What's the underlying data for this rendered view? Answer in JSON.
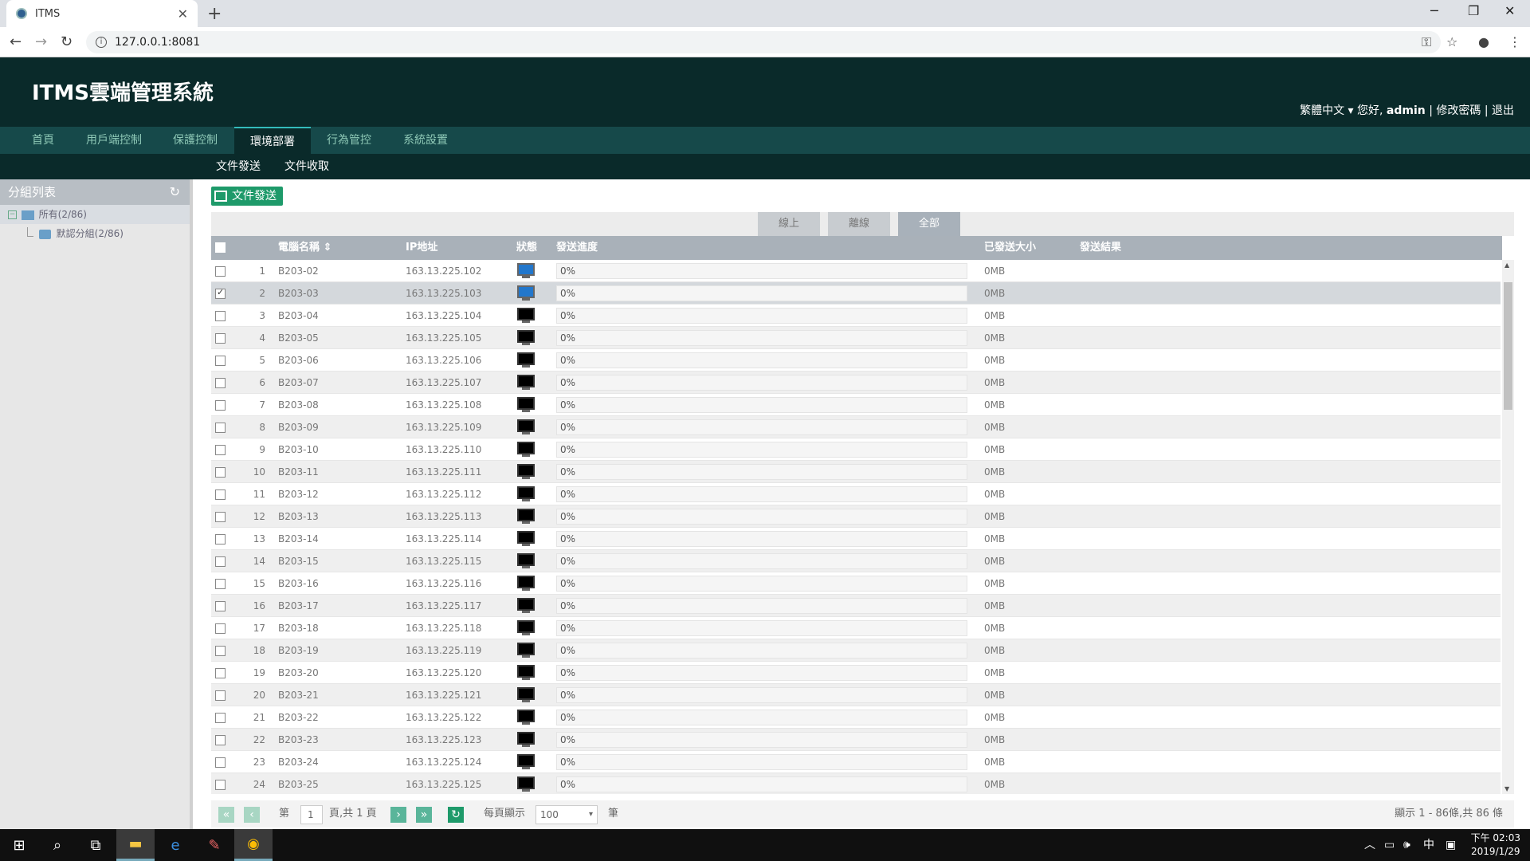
{
  "browser": {
    "tab_title": "ITMS",
    "url": "127.0.0.1:8081"
  },
  "app": {
    "title": "ITMS雲端管理系統",
    "language": "繁體中文",
    "greeting": "您好,",
    "username": "admin",
    "change_password": "修改密碼",
    "logout": "退出",
    "separator": "|"
  },
  "main_nav": [
    "首頁",
    "用戶端控制",
    "保護控制",
    "環境部署",
    "行為管控",
    "系統設置"
  ],
  "main_nav_active": 3,
  "sub_nav": [
    "文件發送",
    "文件收取"
  ],
  "sidebar": {
    "title": "分組列表",
    "tree": [
      {
        "label": "所有(2/86)"
      },
      {
        "label": "默認分組(2/86)"
      }
    ]
  },
  "toolbar": {
    "send_button": "文件發送"
  },
  "filters": [
    "線上",
    "離線",
    "全部"
  ],
  "filter_active": 2,
  "columns": {
    "name": "電腦名稱",
    "ip": "IP地址",
    "status": "狀態",
    "progress": "發送進度",
    "sent_size": "已發送大小",
    "result": "發送結果"
  },
  "rows": [
    {
      "no": "1",
      "name": "B203-02",
      "ip": "163.13.225.102",
      "online": true,
      "checked": false,
      "progress": 0,
      "progress_text": "0%",
      "size": "0MB",
      "result": ""
    },
    {
      "no": "2",
      "name": "B203-03",
      "ip": "163.13.225.103",
      "online": true,
      "checked": true,
      "progress": 0,
      "progress_text": "0%",
      "size": "0MB",
      "result": ""
    },
    {
      "no": "3",
      "name": "B203-04",
      "ip": "163.13.225.104",
      "online": false,
      "checked": false,
      "progress": 0,
      "progress_text": "0%",
      "size": "0MB",
      "result": ""
    },
    {
      "no": "4",
      "name": "B203-05",
      "ip": "163.13.225.105",
      "online": false,
      "checked": false,
      "progress": 0,
      "progress_text": "0%",
      "size": "0MB",
      "result": ""
    },
    {
      "no": "5",
      "name": "B203-06",
      "ip": "163.13.225.106",
      "online": false,
      "checked": false,
      "progress": 0,
      "progress_text": "0%",
      "size": "0MB",
      "result": ""
    },
    {
      "no": "6",
      "name": "B203-07",
      "ip": "163.13.225.107",
      "online": false,
      "checked": false,
      "progress": 0,
      "progress_text": "0%",
      "size": "0MB",
      "result": ""
    },
    {
      "no": "7",
      "name": "B203-08",
      "ip": "163.13.225.108",
      "online": false,
      "checked": false,
      "progress": 0,
      "progress_text": "0%",
      "size": "0MB",
      "result": ""
    },
    {
      "no": "8",
      "name": "B203-09",
      "ip": "163.13.225.109",
      "online": false,
      "checked": false,
      "progress": 0,
      "progress_text": "0%",
      "size": "0MB",
      "result": ""
    },
    {
      "no": "9",
      "name": "B203-10",
      "ip": "163.13.225.110",
      "online": false,
      "checked": false,
      "progress": 0,
      "progress_text": "0%",
      "size": "0MB",
      "result": ""
    },
    {
      "no": "10",
      "name": "B203-11",
      "ip": "163.13.225.111",
      "online": false,
      "checked": false,
      "progress": 0,
      "progress_text": "0%",
      "size": "0MB",
      "result": ""
    },
    {
      "no": "11",
      "name": "B203-12",
      "ip": "163.13.225.112",
      "online": false,
      "checked": false,
      "progress": 0,
      "progress_text": "0%",
      "size": "0MB",
      "result": ""
    },
    {
      "no": "12",
      "name": "B203-13",
      "ip": "163.13.225.113",
      "online": false,
      "checked": false,
      "progress": 0,
      "progress_text": "0%",
      "size": "0MB",
      "result": ""
    },
    {
      "no": "13",
      "name": "B203-14",
      "ip": "163.13.225.114",
      "online": false,
      "checked": false,
      "progress": 0,
      "progress_text": "0%",
      "size": "0MB",
      "result": ""
    },
    {
      "no": "14",
      "name": "B203-15",
      "ip": "163.13.225.115",
      "online": false,
      "checked": false,
      "progress": 0,
      "progress_text": "0%",
      "size": "0MB",
      "result": ""
    },
    {
      "no": "15",
      "name": "B203-16",
      "ip": "163.13.225.116",
      "online": false,
      "checked": false,
      "progress": 0,
      "progress_text": "0%",
      "size": "0MB",
      "result": ""
    },
    {
      "no": "16",
      "name": "B203-17",
      "ip": "163.13.225.117",
      "online": false,
      "checked": false,
      "progress": 0,
      "progress_text": "0%",
      "size": "0MB",
      "result": ""
    },
    {
      "no": "17",
      "name": "B203-18",
      "ip": "163.13.225.118",
      "online": false,
      "checked": false,
      "progress": 0,
      "progress_text": "0%",
      "size": "0MB",
      "result": ""
    },
    {
      "no": "18",
      "name": "B203-19",
      "ip": "163.13.225.119",
      "online": false,
      "checked": false,
      "progress": 0,
      "progress_text": "0%",
      "size": "0MB",
      "result": ""
    },
    {
      "no": "19",
      "name": "B203-20",
      "ip": "163.13.225.120",
      "online": false,
      "checked": false,
      "progress": 0,
      "progress_text": "0%",
      "size": "0MB",
      "result": ""
    },
    {
      "no": "20",
      "name": "B203-21",
      "ip": "163.13.225.121",
      "online": false,
      "checked": false,
      "progress": 0,
      "progress_text": "0%",
      "size": "0MB",
      "result": ""
    },
    {
      "no": "21",
      "name": "B203-22",
      "ip": "163.13.225.122",
      "online": false,
      "checked": false,
      "progress": 0,
      "progress_text": "0%",
      "size": "0MB",
      "result": ""
    },
    {
      "no": "22",
      "name": "B203-23",
      "ip": "163.13.225.123",
      "online": false,
      "checked": false,
      "progress": 0,
      "progress_text": "0%",
      "size": "0MB",
      "result": ""
    },
    {
      "no": "23",
      "name": "B203-24",
      "ip": "163.13.225.124",
      "online": false,
      "checked": false,
      "progress": 0,
      "progress_text": "0%",
      "size": "0MB",
      "result": ""
    },
    {
      "no": "24",
      "name": "B203-25",
      "ip": "163.13.225.125",
      "online": false,
      "checked": false,
      "progress": 0,
      "progress_text": "0%",
      "size": "0MB",
      "result": ""
    }
  ],
  "pager": {
    "page_prefix": "第",
    "page_value": "1",
    "page_suffix": "頁,共 1 頁",
    "per_page_label": "每頁顯示",
    "per_page_value": "100",
    "unit": "筆",
    "summary": "顯示 1 - 86條,共 86 條"
  },
  "taskbar": {
    "ime": "中",
    "time_period": "下午 02:03",
    "date": "2019/1/29"
  },
  "colors": {
    "header_bg": "#0a2a2a",
    "nav_bg": "#16494a",
    "accent": "#1e9a6a",
    "online_monitor": "#2277cc"
  }
}
